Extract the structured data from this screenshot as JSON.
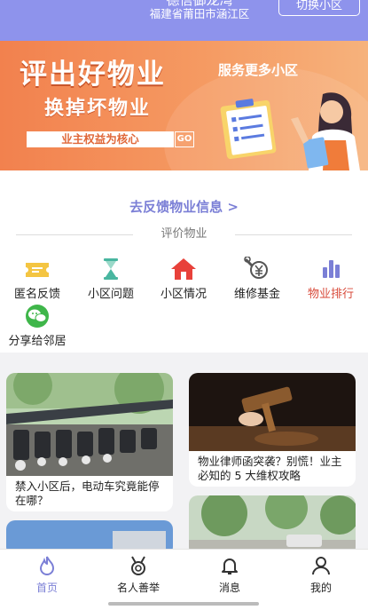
{
  "header": {
    "community_name": "德信御龙湾",
    "region": "福建省莆田市涵江区",
    "switch_label": "切换小区"
  },
  "banner": {
    "headline": "评出好物业",
    "subline": "换掉坏物业",
    "side_text": "服务更多小区",
    "box_text": "业主权益为核心",
    "go_label": "GO"
  },
  "feedback": {
    "link_text": "去反馈物业信息 >"
  },
  "section": {
    "title": "评价物业"
  },
  "grid": {
    "items": [
      {
        "label": "匿名反馈",
        "icon": "ticket-icon",
        "color": "#f4c542"
      },
      {
        "label": "小区问题",
        "icon": "hourglass-icon",
        "color": "#49b6a0"
      },
      {
        "label": "小区情况",
        "icon": "home-icon",
        "color": "#e8413a"
      },
      {
        "label": "维修基金",
        "icon": "wrench-money-icon",
        "color": "#555555"
      },
      {
        "label": "物业排行",
        "icon": "bar-chart-icon",
        "color": "#7b7fd6"
      },
      {
        "label": "分享给邻居",
        "icon": "wechat-icon",
        "color": "#3fb64a"
      }
    ]
  },
  "cards": [
    {
      "caption": "禁入小区后，电动车究竟能停在哪？"
    },
    {
      "caption": "物业律师函突袭？别慌！业主必知的 5 大维权攻略"
    }
  ],
  "nav": {
    "items": [
      {
        "label": "首页",
        "icon": "flame-icon",
        "active": true
      },
      {
        "label": "名人善举",
        "icon": "medal-icon",
        "active": false
      },
      {
        "label": "消息",
        "icon": "bell-icon",
        "active": false
      },
      {
        "label": "我的",
        "icon": "user-icon",
        "active": false
      }
    ]
  },
  "colors": {
    "header_bg": "#8e93ec",
    "banner_bg": "#f2814e",
    "accent": "#7b7fd6",
    "rank_label": "#d84a3a"
  }
}
